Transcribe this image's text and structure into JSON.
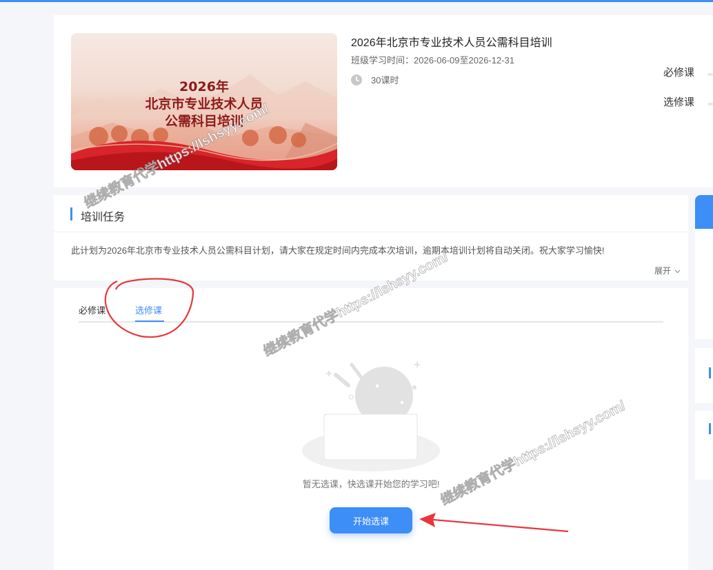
{
  "course": {
    "banner_year": "2026年",
    "banner_line2": "北京市专业技术人员",
    "banner_line3": "公需科目培训",
    "title": "2026年北京市专业技术人员公需科目培训",
    "period": "班级学习时间：2026-06-09至2026-12-31",
    "hours": "30课时",
    "summary_required": "必修课",
    "summary_elective": "选修课"
  },
  "task": {
    "title": "培训任务",
    "description": "此计划为2026年北京市专业技术人员公需科目计划，请大家在规定时间内完成本次培训，逾期本培训计划将自动关闭。祝大家学习愉快!",
    "expand": "展开"
  },
  "tabs": {
    "required": "必修课",
    "elective": "选修课"
  },
  "empty": {
    "message": "暂无选课，快选课开始您的学习吧!",
    "button": "开始选课"
  },
  "watermark": "继续教育代学https://lshsyy.com/",
  "icons": {
    "clock": "clock-icon",
    "expand": "chevron-down-icon"
  },
  "colors": {
    "accent": "#3d8ef7",
    "annotation": "#e8363c"
  }
}
